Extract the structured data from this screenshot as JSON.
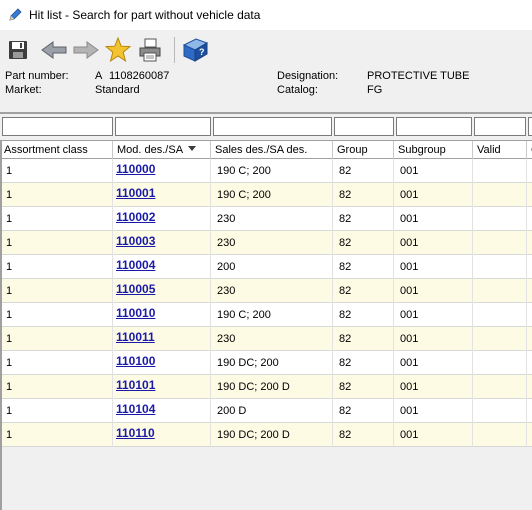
{
  "window": {
    "title": "Hit list - Search for part without vehicle data"
  },
  "toolbar": {
    "buttons": [
      {
        "name": "save",
        "icon": "floppy-disk-icon"
      },
      {
        "name": "back",
        "icon": "arrow-left-icon"
      },
      {
        "name": "forward",
        "icon": "arrow-right-icon"
      },
      {
        "name": "favorite",
        "icon": "star-icon"
      },
      {
        "name": "print",
        "icon": "printer-icon"
      },
      {
        "name": "help",
        "icon": "help-book-icon"
      }
    ]
  },
  "part_info": {
    "part_number_label": "Part number:",
    "part_number_prefix": "A",
    "part_number_value": "1108260087",
    "market_label": "Market:",
    "market_value": "Standard",
    "designation_label": "Designation:",
    "designation_value": "PROTECTIVE TUBE",
    "catalog_label": "Catalog:",
    "catalog_value": "FG"
  },
  "table": {
    "columns": [
      {
        "key": "assortment",
        "label": "Assortment class"
      },
      {
        "key": "mod",
        "label": "Mod. des./SA",
        "sorted": "desc"
      },
      {
        "key": "sales",
        "label": "Sales des./SA des."
      },
      {
        "key": "group",
        "label": "Group"
      },
      {
        "key": "subgroup",
        "label": "Subgroup"
      },
      {
        "key": "valid",
        "label": "Valid"
      },
      {
        "key": "extra",
        "label": "C"
      }
    ],
    "rows": [
      {
        "assortment": "1",
        "mod": "110000",
        "sales": "190 C; 200",
        "group": "82",
        "subgroup": "001"
      },
      {
        "assortment": "1",
        "mod": "110001",
        "sales": "190 C; 200",
        "group": "82",
        "subgroup": "001"
      },
      {
        "assortment": "1",
        "mod": "110002",
        "sales": "230",
        "group": "82",
        "subgroup": "001"
      },
      {
        "assortment": "1",
        "mod": "110003",
        "sales": "230",
        "group": "82",
        "subgroup": "001"
      },
      {
        "assortment": "1",
        "mod": "110004",
        "sales": "200",
        "group": "82",
        "subgroup": "001"
      },
      {
        "assortment": "1",
        "mod": "110005",
        "sales": "230",
        "group": "82",
        "subgroup": "001"
      },
      {
        "assortment": "1",
        "mod": "110010",
        "sales": "190 C; 200",
        "group": "82",
        "subgroup": "001"
      },
      {
        "assortment": "1",
        "mod": "110011",
        "sales": "230",
        "group": "82",
        "subgroup": "001"
      },
      {
        "assortment": "1",
        "mod": "110100",
        "sales": "190 DC; 200",
        "group": "82",
        "subgroup": "001"
      },
      {
        "assortment": "1",
        "mod": "110101",
        "sales": "190 DC; 200 D",
        "group": "82",
        "subgroup": "001"
      },
      {
        "assortment": "1",
        "mod": "110104",
        "sales": "200 D",
        "group": "82",
        "subgroup": "001"
      },
      {
        "assortment": "1",
        "mod": "110110",
        "sales": "190 DC; 200 D",
        "group": "82",
        "subgroup": "001"
      }
    ]
  }
}
